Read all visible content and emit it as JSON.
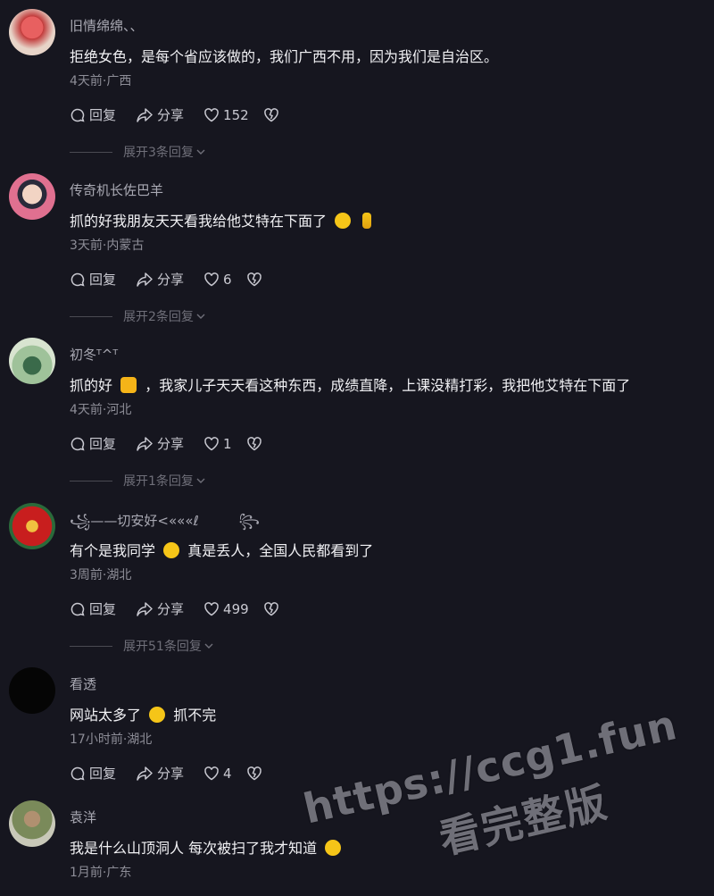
{
  "actions": {
    "reply": "回复",
    "share": "分享"
  },
  "comments": [
    {
      "username": "旧情绵绵、、",
      "content": "拒绝女色，是每个省应该做的，我们广西不用，因为我们是自治区。",
      "meta": "4天前·广西",
      "likes": "152",
      "expand": "展开3条回复",
      "avatar_color": "#c23a3a"
    },
    {
      "username": "传奇机长佐巴羊",
      "content": "抓的好我朋友天天看我给他艾特在下面了",
      "emojis": [
        "laughing-tears",
        "crossed-fingers"
      ],
      "meta": "3天前·内蒙古",
      "likes": "6",
      "expand": "展开2条回复",
      "avatar_color": "#d86a8a"
    },
    {
      "username": "初冬ᵀ^ᵀ",
      "content_a": "抓的好",
      "content_b": "，我家儿子天天看这种东西，成绩直降，上课没精打彩，我把他艾特在下面了",
      "emojis": [
        "thumbs-up"
      ],
      "meta": "4天前·河北",
      "likes": "1",
      "expand": "展开1条回复",
      "avatar_color": "#7fa47a"
    },
    {
      "username": "꧁——切安好<«««ℓ",
      "username_tail": "꧂",
      "content_a": "有个是我同学",
      "content_b": "真是丢人，全国人民都看到了",
      "emojis": [
        "laughing-tears"
      ],
      "meta": "3周前·湖北",
      "likes": "499",
      "expand": "展开51条回复",
      "avatar_color": "#b01818"
    },
    {
      "username": "看透",
      "content_a": "网站太多了",
      "content_b": "抓不完",
      "emojis": [
        "thinking-face"
      ],
      "meta": "17小时前·湖北",
      "likes": "4",
      "avatar_color": "#050505"
    },
    {
      "username": "袁洋",
      "content": "我是什么山顶洞人 每次被扫了我才知道",
      "emojis": [
        "crying-face"
      ],
      "meta": "1月前·广东",
      "avatar_color": "#7a8a5a"
    }
  ],
  "watermark": {
    "line1": "https://ccg1.fun",
    "line2": "看完整版"
  },
  "colors": {
    "background": "#16161f",
    "accent_gray": "#8d8d97",
    "emoji_yellow": "#f5c518"
  }
}
